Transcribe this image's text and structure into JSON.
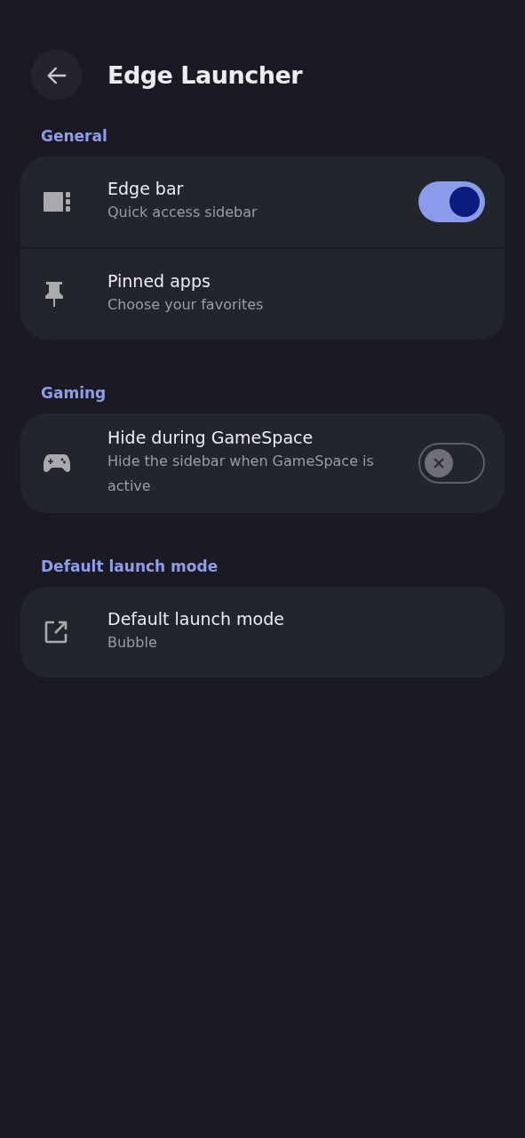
{
  "header": {
    "title": "Edge Launcher"
  },
  "sections": [
    {
      "title": "General",
      "items": [
        {
          "kind": "switch",
          "title": "Edge bar",
          "subtitle": "Quick access sidebar",
          "on": true
        },
        {
          "kind": "link",
          "title": "Pinned apps",
          "subtitle": "Choose your favorites"
        }
      ]
    },
    {
      "title": "Gaming",
      "items": [
        {
          "kind": "switch",
          "title": "Hide during GameSpace",
          "subtitle": "Hide the sidebar when GameSpace is active",
          "on": false
        }
      ]
    },
    {
      "title": "Default launch mode",
      "items": [
        {
          "kind": "link",
          "title": "Default launch mode",
          "subtitle": "Bubble"
        }
      ]
    }
  ]
}
